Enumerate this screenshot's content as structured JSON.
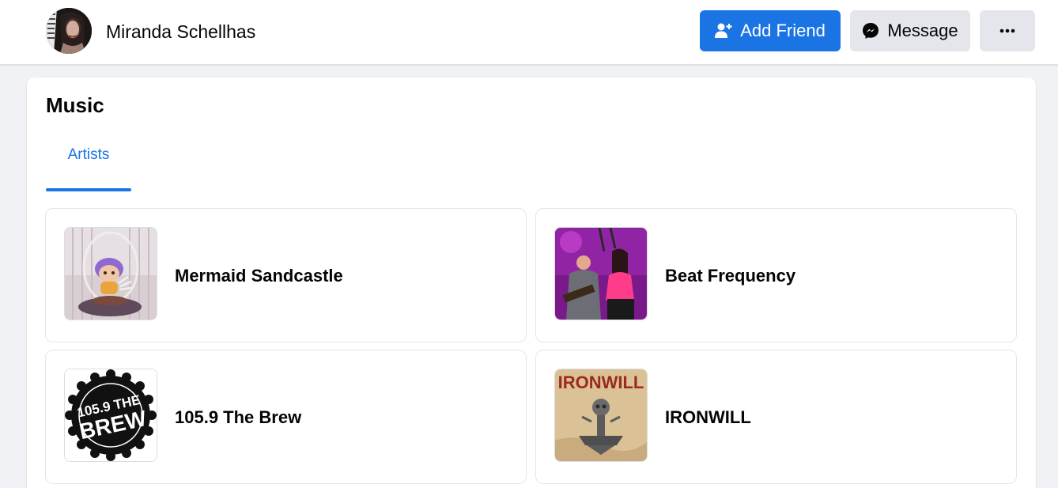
{
  "header": {
    "profile_name": "Miranda Schellhas",
    "add_friend_label": "Add Friend",
    "message_label": "Message",
    "more_label": "···"
  },
  "music": {
    "title": "Music",
    "tabs": [
      {
        "label": "Artists",
        "active": true
      }
    ],
    "artists": [
      {
        "name": "Mermaid Sandcastle",
        "thumb_icon": "mermaid-toy-photo"
      },
      {
        "name": "Beat Frequency",
        "thumb_icon": "band-concert-photo"
      },
      {
        "name": "105.9 The Brew",
        "thumb_icon": "brew-logo",
        "logo_text": "105.9 THE BREW"
      },
      {
        "name": "IRONWILL",
        "thumb_icon": "ironwill-album-art",
        "logo_text": "IRONWILL"
      }
    ]
  },
  "colors": {
    "accent": "#1b74e4",
    "page_background": "#f0f2f5",
    "secondary_button": "#e4e6eb"
  }
}
